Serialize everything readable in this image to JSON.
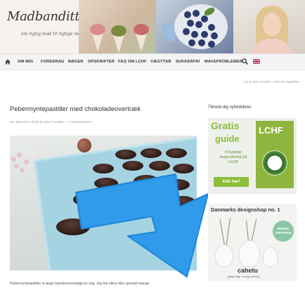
{
  "header": {
    "logo": "Madbanditten",
    "tagline": "om rigtig mad til rigtige mennesker"
  },
  "nav": {
    "items": [
      "OM MIG",
      "FOREDRAG",
      "BØGER",
      "OPSKRIFTER",
      "FAQ OM LCHF",
      "VÆGTTAB",
      "SUKKERFRI",
      "MAVEPROBLEMER"
    ],
    "icons": [
      "home-icon",
      "search-icon",
      "flag-icon"
    ]
  },
  "breadcrumb": "Du er her: Forside / Arkiv for Opskrifter",
  "post": {
    "title": "Pebermyntepastiller med chokoladeovertræk",
    "meta": "18. december 2016 af Jane Faerber — 4 kommentarer",
    "excerpt": "Pebermyntepastiller er ægte barndomsnostalgi for mig. Jeg har ellers ikke specielt mange"
  },
  "sidebar": {
    "title": "Tilmeld dig nyhedsbrev",
    "ad1": {
      "gratis": "Gratis",
      "guide": "guide",
      "text": "4 hyppige begynderfejl på LCHF",
      "button": "Klik her!",
      "book": "LCHF"
    },
    "ad2": {
      "title": "Danmarks designshop no. 1",
      "badge_line1": "BESØG",
      "badge_line2": "SHOPPEN",
      "brand": "cahetu",
      "small": "gratis fragt · hurtig levering"
    }
  },
  "colors": {
    "accent_green": "#8cbd3b",
    "arrow_blue": "#2f9bea",
    "nav_bg": "#f4f4f4"
  }
}
